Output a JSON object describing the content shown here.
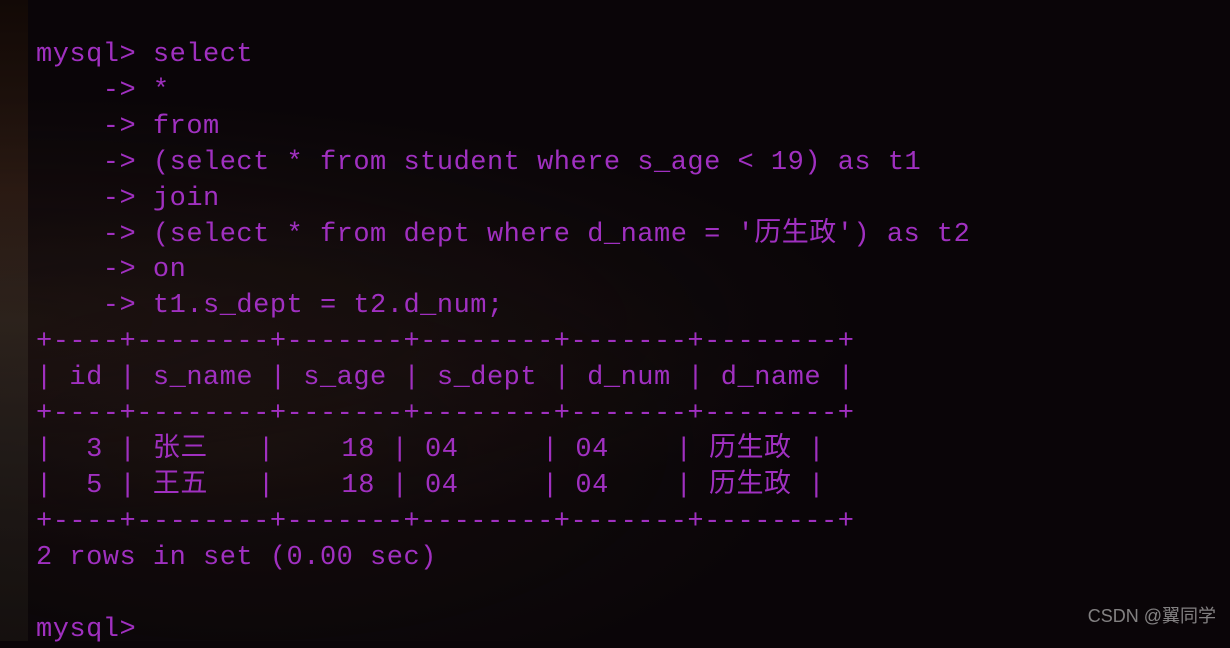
{
  "terminal": {
    "prompt": "mysql>",
    "continuation": "    ->",
    "query_lines": [
      "select",
      "*",
      "from",
      "(select * from student where s_age < 19) as t1",
      "join",
      "(select * from dept where d_name = '历生政') as t2",
      "on",
      "t1.s_dept = t2.d_num;"
    ],
    "table": {
      "border_top": "+----+--------+-------+--------+-------+--------+",
      "header": "| id | s_name | s_age | s_dept | d_num | d_name |",
      "border_mid": "+----+--------+-------+--------+-------+--------+",
      "rows": [
        "|  3 | 张三   |    18 | 04     | 04    | 历生政 |",
        "|  5 | 王五   |    18 | 04     | 04    | 历生政 |"
      ],
      "border_bottom": "+----+--------+-------+--------+-------+--------+"
    },
    "result_summary": "2 rows in set (0.00 sec)",
    "next_prompt": "mysql>"
  },
  "watermark": "CSDN @翼同学",
  "chart_data": {
    "type": "table",
    "columns": [
      "id",
      "s_name",
      "s_age",
      "s_dept",
      "d_num",
      "d_name"
    ],
    "rows": [
      [
        3,
        "张三",
        18,
        "04",
        "04",
        "历生政"
      ],
      [
        5,
        "王五",
        18,
        "04",
        "04",
        "历生政"
      ]
    ]
  }
}
